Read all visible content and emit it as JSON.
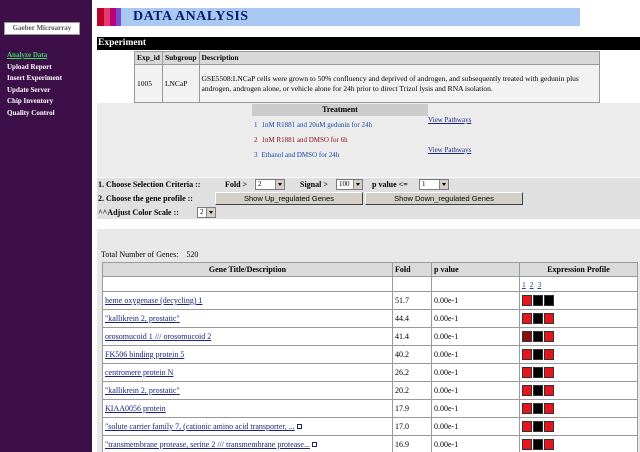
{
  "sidebar": {
    "brand": "Gaeber Microarray",
    "nav": [
      {
        "label": "Analyze Data",
        "active": true
      },
      {
        "label": "Upload Report",
        "active": false
      },
      {
        "label": "Insert Experiment",
        "active": false
      },
      {
        "label": "Update Server",
        "active": false
      },
      {
        "label": "Chip Inventory",
        "active": false
      },
      {
        "label": "Quality Control",
        "active": false
      }
    ]
  },
  "header": {
    "title": "DATA ANALYSIS",
    "section": "Experiment"
  },
  "experiment_table": {
    "columns": [
      "Exp_id",
      "Subgroup",
      "Description"
    ],
    "row": {
      "exp_id": "1005",
      "subgroup": "LNCaP",
      "description": "GSE5508:LNCaP cells were grown to 50% confluency and deprived of androgen, and subsequently treated with gedunin plus androgen, androgen alone, or vehicle alone for 24h prior to direct Trizol lysis and RNA isolation."
    }
  },
  "treatment": {
    "heading": "Treatment",
    "items": [
      {
        "num": "1",
        "label": "1nM R1881 and 20uM gedunin for 24h"
      },
      {
        "num": "2",
        "label": "1nM R1881 and DMSO for 6h"
      },
      {
        "num": "3",
        "label": "Ethanol and DMSO for 24h"
      }
    ],
    "pathway_links": [
      "View Pathways",
      "View Pathways"
    ]
  },
  "criteria": {
    "label": "1. Choose Selection Criteria ::",
    "fold_label": "Fold >",
    "fold_value": "2",
    "signal_label": "Signal >",
    "signal_value": "100",
    "pvalue_label": "p value <=",
    "pvalue_value": "1"
  },
  "profile": {
    "label": "2. Choose the gene profile ::",
    "up_button": "Show Up_regulated Genes",
    "down_button": "Show Down_regulated Genes"
  },
  "scale": {
    "label": "^^Adjust Color Scale ::",
    "value": "2"
  },
  "results": {
    "total_label": "Total Number of Genes:",
    "total_value": "520",
    "columns": [
      "Gene Title/Description",
      "Fold",
      "p value",
      "Expression Profile"
    ],
    "profile_numbers": [
      "1",
      "2",
      "3"
    ],
    "colors": {
      "red": "#e8141b",
      "black": "#000000",
      "dark_red": "#8b0d0d"
    },
    "rows": [
      {
        "gene": "heme oxygenase (decycling) 1",
        "fold": "51.7",
        "pvalue": "0.00e-1",
        "heat": [
          "red",
          "black",
          "black"
        ],
        "ext": false
      },
      {
        "gene": "\"kallikrein 2, prostatic\"",
        "fold": "44.4",
        "pvalue": "0.00e-1",
        "heat": [
          "red",
          "black",
          "red"
        ],
        "ext": false
      },
      {
        "gene": "orosomucoid 1 /// orosomucoid 2",
        "fold": "41.4",
        "pvalue": "0.00e-1",
        "heat": [
          "dark_red",
          "black",
          "red"
        ],
        "ext": false
      },
      {
        "gene": "FK506 binding protein 5",
        "fold": "40.2",
        "pvalue": "0.00e-1",
        "heat": [
          "red",
          "black",
          "red"
        ],
        "ext": false
      },
      {
        "gene": "centromere protein N",
        "fold": "26.2",
        "pvalue": "0.00e-1",
        "heat": [
          "red",
          "black",
          "red"
        ],
        "ext": false
      },
      {
        "gene": "\"kallikrein 2, prostatic\"",
        "fold": "20.2",
        "pvalue": "0.00e-1",
        "heat": [
          "red",
          "black",
          "red"
        ],
        "ext": false
      },
      {
        "gene": "KIAA0056 protein",
        "fold": "17.9",
        "pvalue": "0.00e-1",
        "heat": [
          "red",
          "black",
          "red"
        ],
        "ext": false
      },
      {
        "gene": "\"solute carrier family 7, (cationic amino acid transporter, ...",
        "fold": "17.0",
        "pvalue": "0.00e-1",
        "heat": [
          "red",
          "black",
          "red"
        ],
        "ext": true
      },
      {
        "gene": "\"transmembrane protease, serine 2 /// transmembrane protease...",
        "fold": "16.9",
        "pvalue": "0.00e-1",
        "heat": [
          "red",
          "black",
          "red"
        ],
        "ext": true
      }
    ]
  }
}
